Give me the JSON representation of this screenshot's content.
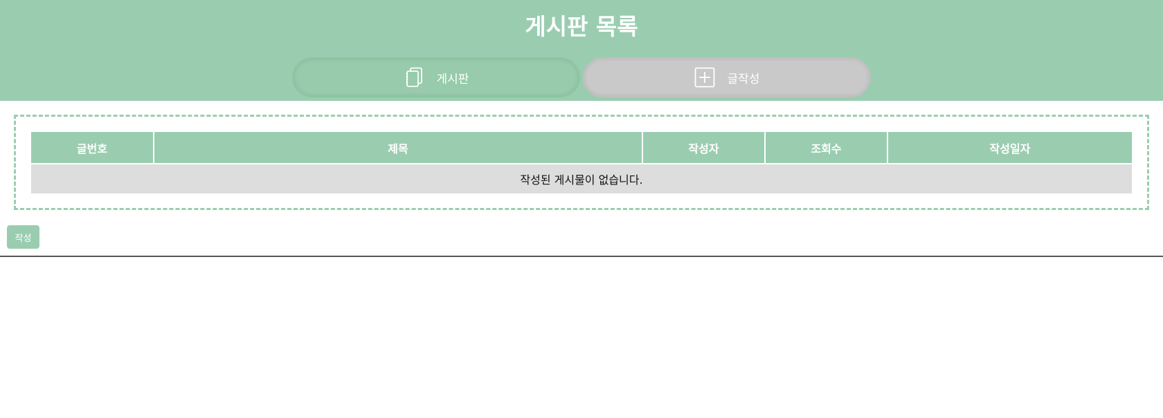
{
  "header": {
    "title": "게시판 목록",
    "nav": {
      "board": {
        "label": "게시판",
        "icon": "notebook-icon"
      },
      "write": {
        "label": "글작성",
        "icon": "plus-square-icon"
      }
    }
  },
  "table": {
    "columns": [
      "글번호",
      "제목",
      "작성자",
      "조회수",
      "작성일자"
    ],
    "empty_message": "작성된 게시물이 없습니다."
  },
  "actions": {
    "write_label": "작성"
  },
  "colors": {
    "accent": "#9acdb0",
    "inactive_tab": "#c9c9c9",
    "empty_row": "#dddddd"
  }
}
